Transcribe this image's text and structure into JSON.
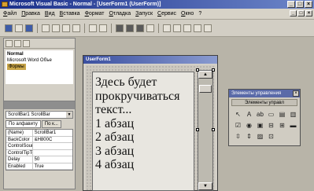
{
  "window": {
    "title": "Microsoft Visual Basic - Normal - [UserForm1 (UserForm)]",
    "controls": [
      "_",
      "□",
      "×"
    ]
  },
  "menu": {
    "items": [
      "Файл",
      "Правка",
      "Вид",
      "Вставка",
      "Формат",
      "Отладка",
      "Запуск",
      "Сервис",
      "Окно",
      "?"
    ],
    "doc_controls": [
      "_",
      "□",
      "×"
    ]
  },
  "project": {
    "root": "Normal",
    "items": [
      "Microsoft Word Объе",
      "Формы"
    ]
  },
  "properties": {
    "object": "ScrollBar1 ScrollBar",
    "tabs": [
      "По алфавиту",
      "По к..."
    ],
    "rows": [
      {
        "name": "(Name)",
        "value": "ScrollBar1"
      },
      {
        "name": "BackColor",
        "value": "&H800C"
      },
      {
        "name": "ControlSourc",
        "value": ""
      },
      {
        "name": "ControlTipTe",
        "value": ""
      },
      {
        "name": "Delay",
        "value": "50"
      },
      {
        "name": "Enabled",
        "value": "True"
      }
    ]
  },
  "form": {
    "title": "UserForm1",
    "text_lines": [
      "Здесь будет",
      "прокручиваться",
      "текст...",
      "1 абзац",
      "2 абзац",
      "3 абзац",
      "4 абзац"
    ]
  },
  "toolbox": {
    "title": "Элементы управления",
    "tab": "Элементы управл",
    "close": "×",
    "tools": [
      {
        "icon": "pointer-icon",
        "glyph": "↖"
      },
      {
        "icon": "label-icon",
        "glyph": "A"
      },
      {
        "icon": "textbox-icon",
        "glyph": "ab"
      },
      {
        "icon": "frame-icon",
        "glyph": "▭"
      },
      {
        "icon": "listbox-icon",
        "glyph": "▤"
      },
      {
        "icon": "combobox-icon",
        "glyph": "▥"
      },
      {
        "icon": "checkbox-icon",
        "glyph": "☑"
      },
      {
        "icon": "option-icon",
        "glyph": "◉"
      },
      {
        "icon": "toggle-icon",
        "glyph": "▣"
      },
      {
        "icon": "tabstrip-icon",
        "glyph": "⊟"
      },
      {
        "icon": "multipage-icon",
        "glyph": "⊞"
      },
      {
        "icon": "commandbutton-icon",
        "glyph": "▬"
      },
      {
        "icon": "scrollbar-icon",
        "glyph": "⇳"
      },
      {
        "icon": "spinbutton-icon",
        "glyph": "⇕"
      },
      {
        "icon": "image-icon",
        "glyph": "▨"
      },
      {
        "icon": "refedit-icon",
        "glyph": "⊡"
      }
    ]
  }
}
